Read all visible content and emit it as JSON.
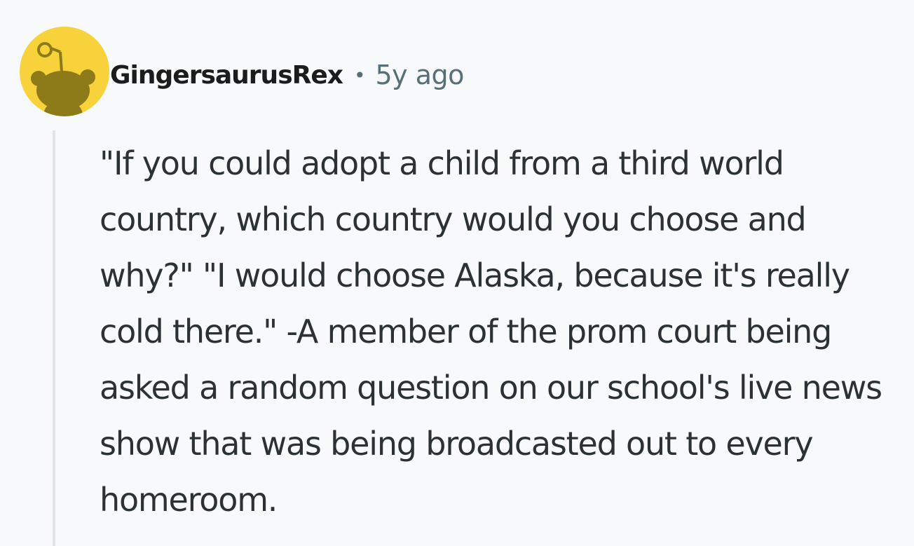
{
  "comment": {
    "author": "GingersaurusRex",
    "separator": "•",
    "timestamp": "5y ago",
    "avatar_icon": "reddit-snoo-avatar-icon",
    "body": "\"If you could adopt a child from a third world country, which country would you choose and why?\" \"I would choose Alaska, because it's really cold there.\" -A member of the prom court being asked a random question on our school's live news show that was being broadcasted out to every homeroom."
  },
  "colors": {
    "background": "#f7f9fa",
    "avatar_background": "#f7d23a",
    "avatar_figure": "#8d7a18",
    "thread_line": "#dfe4e7",
    "meta_text": "#576f76",
    "body_text": "#2a3236"
  }
}
